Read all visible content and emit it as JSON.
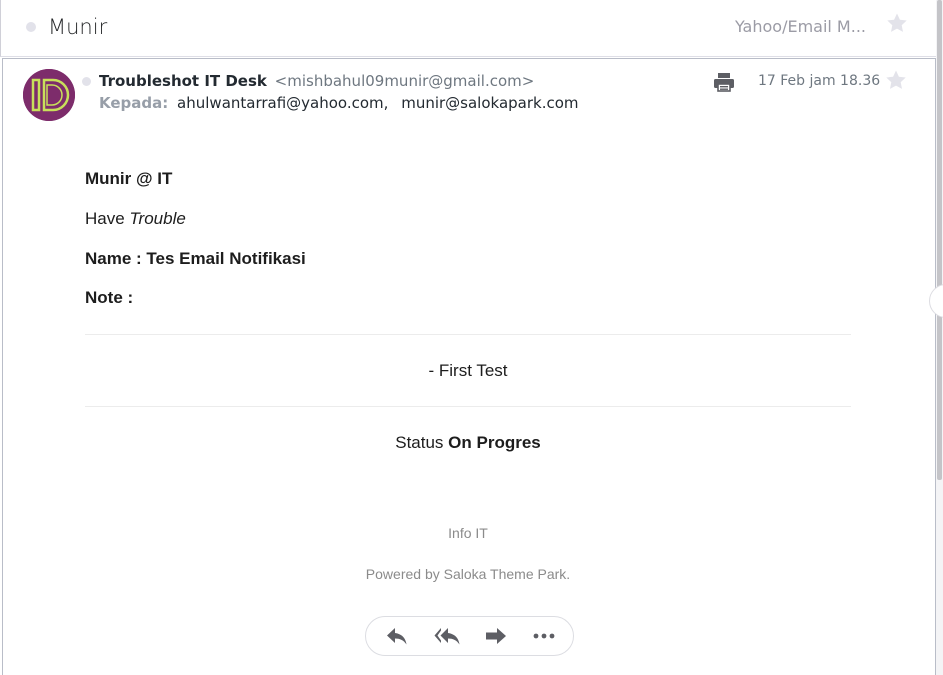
{
  "header": {
    "subject": "Munir",
    "folder": "Yahoo/Email M...",
    "star_icon": "star-icon"
  },
  "message": {
    "avatar_icon": "id-logo-avatar",
    "sender_name": "Troubleshot IT Desk",
    "sender_email": "<mishbahul09munir@gmail.com>",
    "to_label": "Kepada:",
    "recipients": [
      "ahulwantarrafi@yahoo.com,",
      "munir@salokapark.com"
    ],
    "date": "17 Feb jam 18.36",
    "print_icon": "print-icon",
    "star_icon": "star-icon"
  },
  "body": {
    "greeting": "Munir @ IT",
    "have_prefix": "Have ",
    "have_word": "Trouble",
    "name_line": "Name : Tes Email Notifikasi",
    "note_line": "Note :",
    "test_line": "- First Test",
    "status_prefix": "Status ",
    "status_value": "On Progres",
    "info": "Info IT",
    "powered": "Powered by Saloka Theme Park."
  },
  "actions": [
    {
      "name": "reply",
      "icon": "reply-icon"
    },
    {
      "name": "reply-all",
      "icon": "reply-all-icon"
    },
    {
      "name": "forward",
      "icon": "forward-icon"
    },
    {
      "name": "more",
      "icon": "more-icon"
    }
  ],
  "colors": {
    "accent_gray": "#979ea8",
    "avatar_bg": "#7d2c6b",
    "avatar_fg": "#c8e05a",
    "icon_gray": "#5d5e64"
  }
}
